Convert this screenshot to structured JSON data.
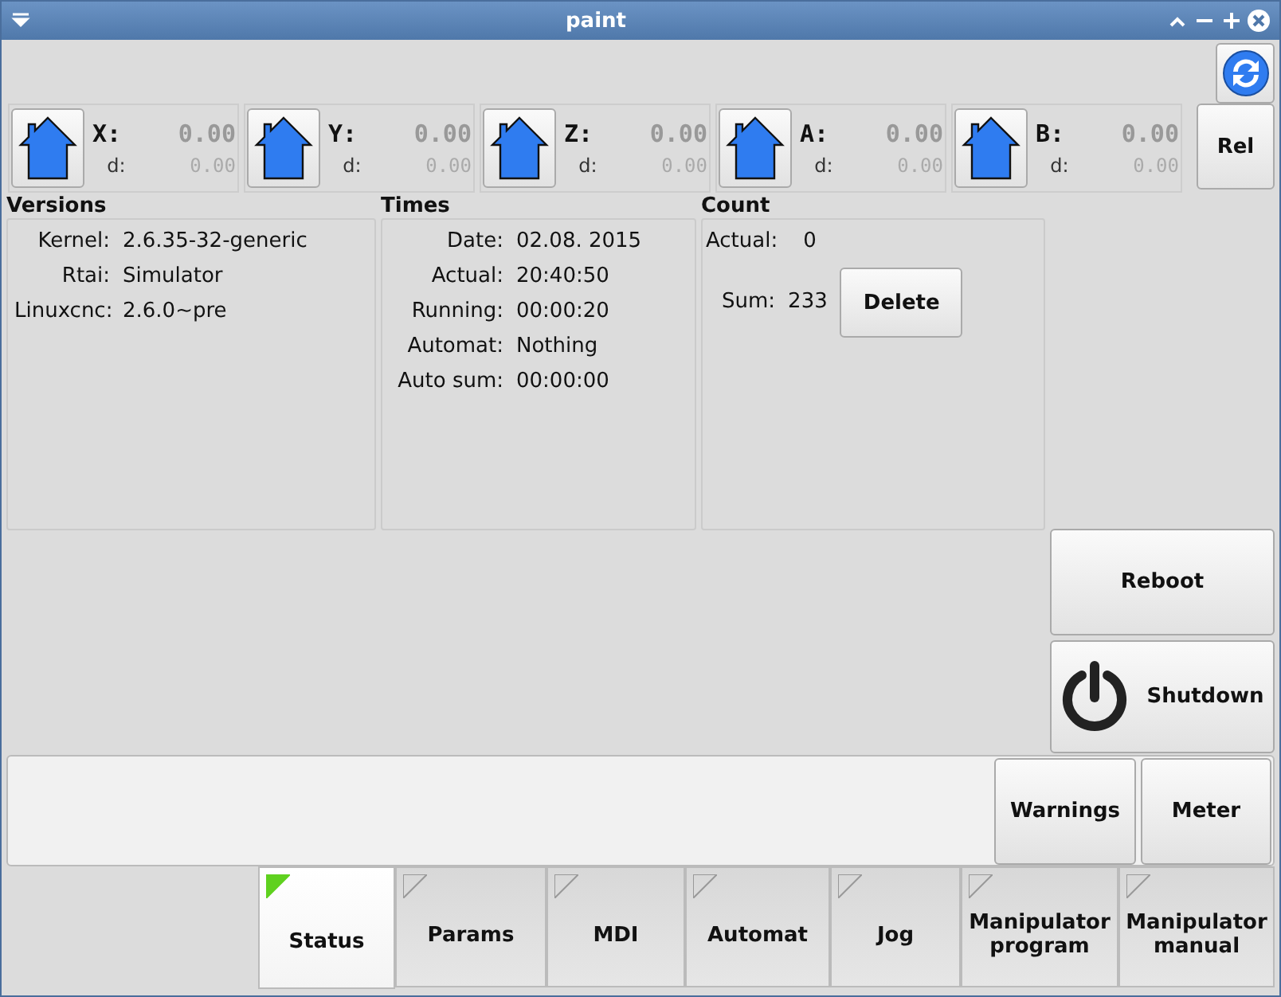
{
  "window": {
    "title": "paint"
  },
  "axes": [
    {
      "label": "X:",
      "value": "0.00",
      "d_label": "d:",
      "d_value": "0.00"
    },
    {
      "label": "Y:",
      "value": "0.00",
      "d_label": "d:",
      "d_value": "0.00"
    },
    {
      "label": "Z:",
      "value": "0.00",
      "d_label": "d:",
      "d_value": "0.00"
    },
    {
      "label": "A:",
      "value": "0.00",
      "d_label": "d:",
      "d_value": "0.00"
    },
    {
      "label": "B:",
      "value": "0.00",
      "d_label": "d:",
      "d_value": "0.00"
    }
  ],
  "rel_button": "Rel",
  "versions": {
    "title": "Versions",
    "rows": [
      {
        "label": "Kernel:",
        "value": "2.6.35-32-generic"
      },
      {
        "label": "Rtai:",
        "value": "Simulator"
      },
      {
        "label": "Linuxcnc:",
        "value": "2.6.0~pre"
      }
    ]
  },
  "times": {
    "title": "Times",
    "rows": [
      {
        "label": "Date:",
        "value": "02.08. 2015"
      },
      {
        "label": "Actual:",
        "value": "20:40:50"
      },
      {
        "label": "Running:",
        "value": "00:00:20"
      },
      {
        "label": "Automat:",
        "value": "Nothing"
      },
      {
        "label": "Auto sum:",
        "value": "00:00:00"
      }
    ]
  },
  "count": {
    "title": "Count",
    "actual_label": "Actual:",
    "actual_value": "0",
    "sum_label": "Sum:",
    "sum_value": "233",
    "delete_button": "Delete"
  },
  "reboot_button": "Reboot",
  "shutdown_button": "Shutdown",
  "bottom_buttons": [
    "Warnings",
    "Meter"
  ],
  "tabs": [
    {
      "label": "Status",
      "selected": true
    },
    {
      "label": "Params",
      "selected": false
    },
    {
      "label": "MDI",
      "selected": false
    },
    {
      "label": "Automat",
      "selected": false
    },
    {
      "label": "Jog",
      "selected": false
    },
    {
      "label": "Manipulator program",
      "selected": false
    },
    {
      "label": "Manipulator manual",
      "selected": false
    }
  ]
}
